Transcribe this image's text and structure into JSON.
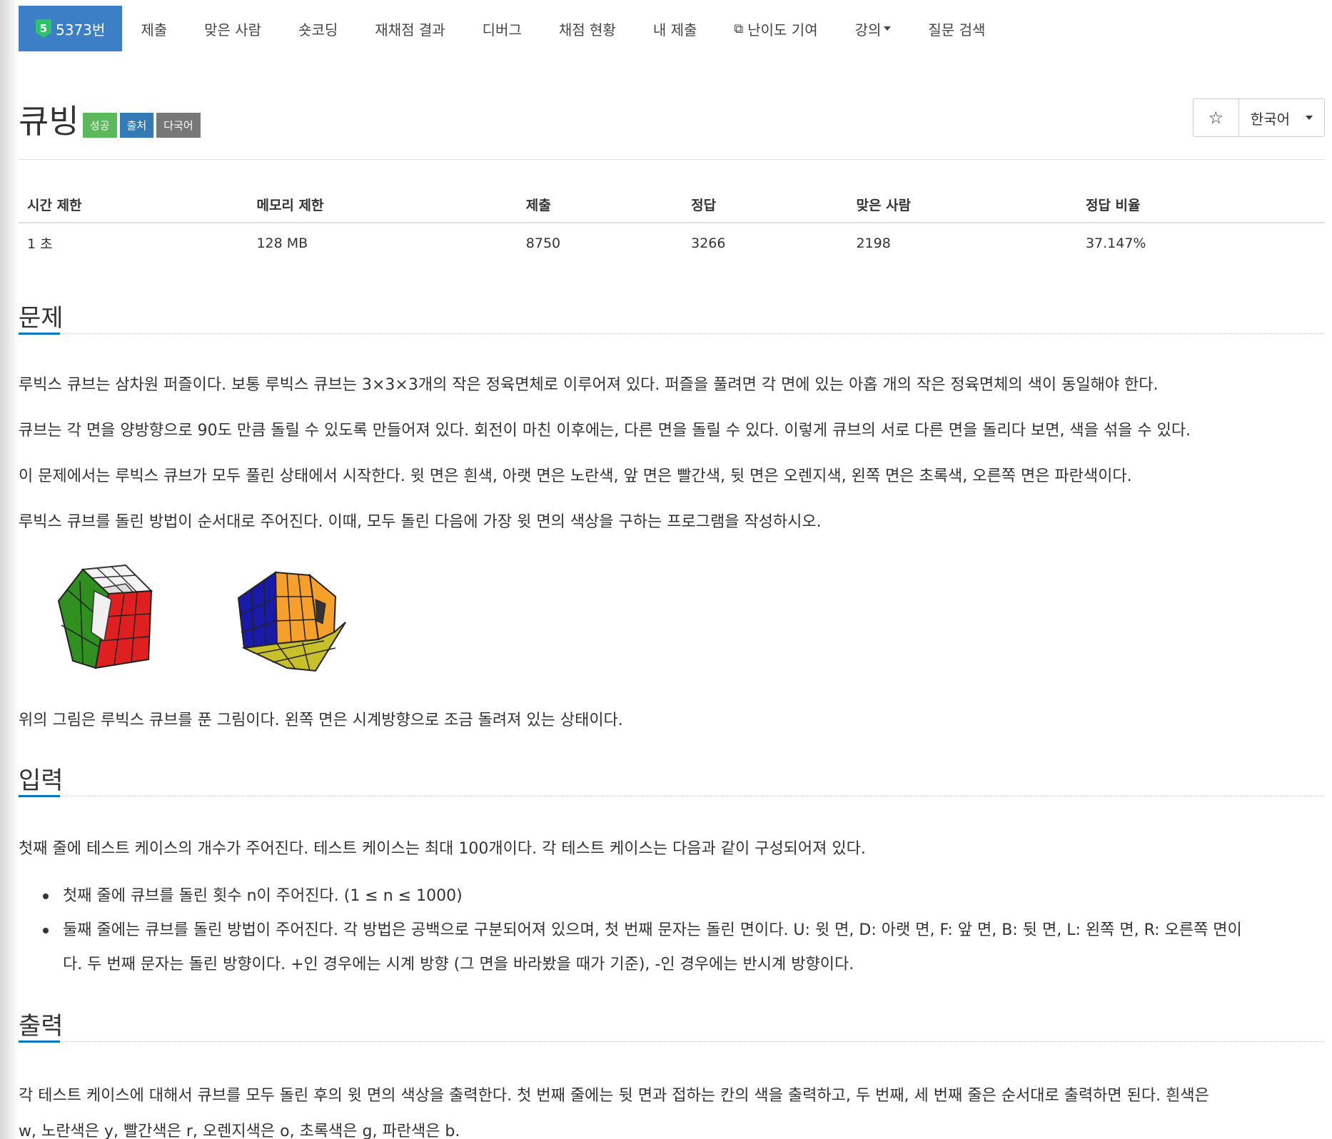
{
  "nav": {
    "problem_id": "5373번",
    "level_badge": "5",
    "items": [
      "제출",
      "맞은 사람",
      "숏코딩",
      "재채점 결과",
      "디버그",
      "채점 현황",
      "내 제출"
    ],
    "contribute": "난이도 기여",
    "lecture": "강의",
    "question_search": "질문 검색"
  },
  "problem": {
    "title": "큐빙",
    "labels": {
      "success": "성공",
      "source": "출처",
      "multilang": "다국어"
    },
    "star": "☆",
    "language": "한국어"
  },
  "info": {
    "headers": [
      "시간 제한",
      "메모리 제한",
      "제출",
      "정답",
      "맞은 사람",
      "정답 비율"
    ],
    "values": [
      "1 초",
      "128 MB",
      "8750",
      "3266",
      "2198",
      "37.147%"
    ]
  },
  "sections": {
    "problem": {
      "heading": "문제",
      "p1": "루빅스 큐브는 삼차원 퍼즐이다. 보통 루빅스 큐브는 3×3×3개의 작은 정육면체로 이루어져 있다. 퍼즐을 풀려면 각 면에 있는 아홉 개의 작은 정육면체의 색이 동일해야 한다.",
      "p2": "큐브는 각 면을 양방향으로 90도 만큼 돌릴 수 있도록 만들어져 있다. 회전이 마친 이후에는, 다른 면을 돌릴 수 있다. 이렇게 큐브의 서로 다른 면을 돌리다 보면, 색을 섞을 수 있다.",
      "p3": "이 문제에서는 루빅스 큐브가 모두 풀린 상태에서 시작한다. 윗 면은 흰색, 아랫 면은 노란색, 앞 면은 빨간색, 뒷 면은 오렌지색, 왼쪽 면은 초록색, 오른쪽 면은 파란색이다.",
      "p4": "루빅스 큐브를 돌린 방법이 순서대로 주어진다. 이때, 모두 돌린 다음에 가장 윗 면의 색상을 구하는 프로그램을 작성하시오.",
      "p5": "위의 그림은 루빅스 큐브를 푼 그림이다. 왼쪽 면은 시계방향으로 조금 돌려져 있는 상태이다."
    },
    "input": {
      "heading": "입력",
      "p1": "첫째 줄에 테스트 케이스의 개수가 주어진다. 테스트 케이스는 최대 100개이다. 각 테스트 케이스는 다음과 같이 구성되어져 있다.",
      "b1": "첫째 줄에 큐브를 돌린 횟수 n이 주어진다. (1 ≤ n ≤ 1000)",
      "b2_line1": "둘째 줄에는 큐브를 돌린 방법이 주어진다. 각 방법은 공백으로 구분되어져 있으며, 첫 번째 문자는 돌린 면이다. U: 윗 면, D: 아랫 면, F: 앞 면, B: 뒷 면, L: 왼쪽 면, R: 오른쪽 면이",
      "b2_line2": "다. 두 번째 문자는 돌린 방향이다. +인 경우에는 시계 방향 (그 면을 바라봤을 때가 기준), -인 경우에는 반시계 방향이다."
    },
    "output": {
      "heading": "출력",
      "p1": "각 테스트 케이스에 대해서 큐브를 모두 돌린 후의 윗 면의 색상을 출력한다. 첫 번째 줄에는 뒷 면과 접하는 칸의 색을 출력하고, 두 번째, 세 번째 줄은 순서대로 출력하면 된다. 흰색은",
      "p2": "w, 노란색은 y, 빨간색은 r, 오렌지색은 o, 초록색은 g, 파란색은 b."
    }
  },
  "colors": {
    "accent": "#3d7fc7",
    "level_badge": "#2cc36b",
    "success": "#5cb85c",
    "source": "#337ab7",
    "multilang": "#777777"
  }
}
